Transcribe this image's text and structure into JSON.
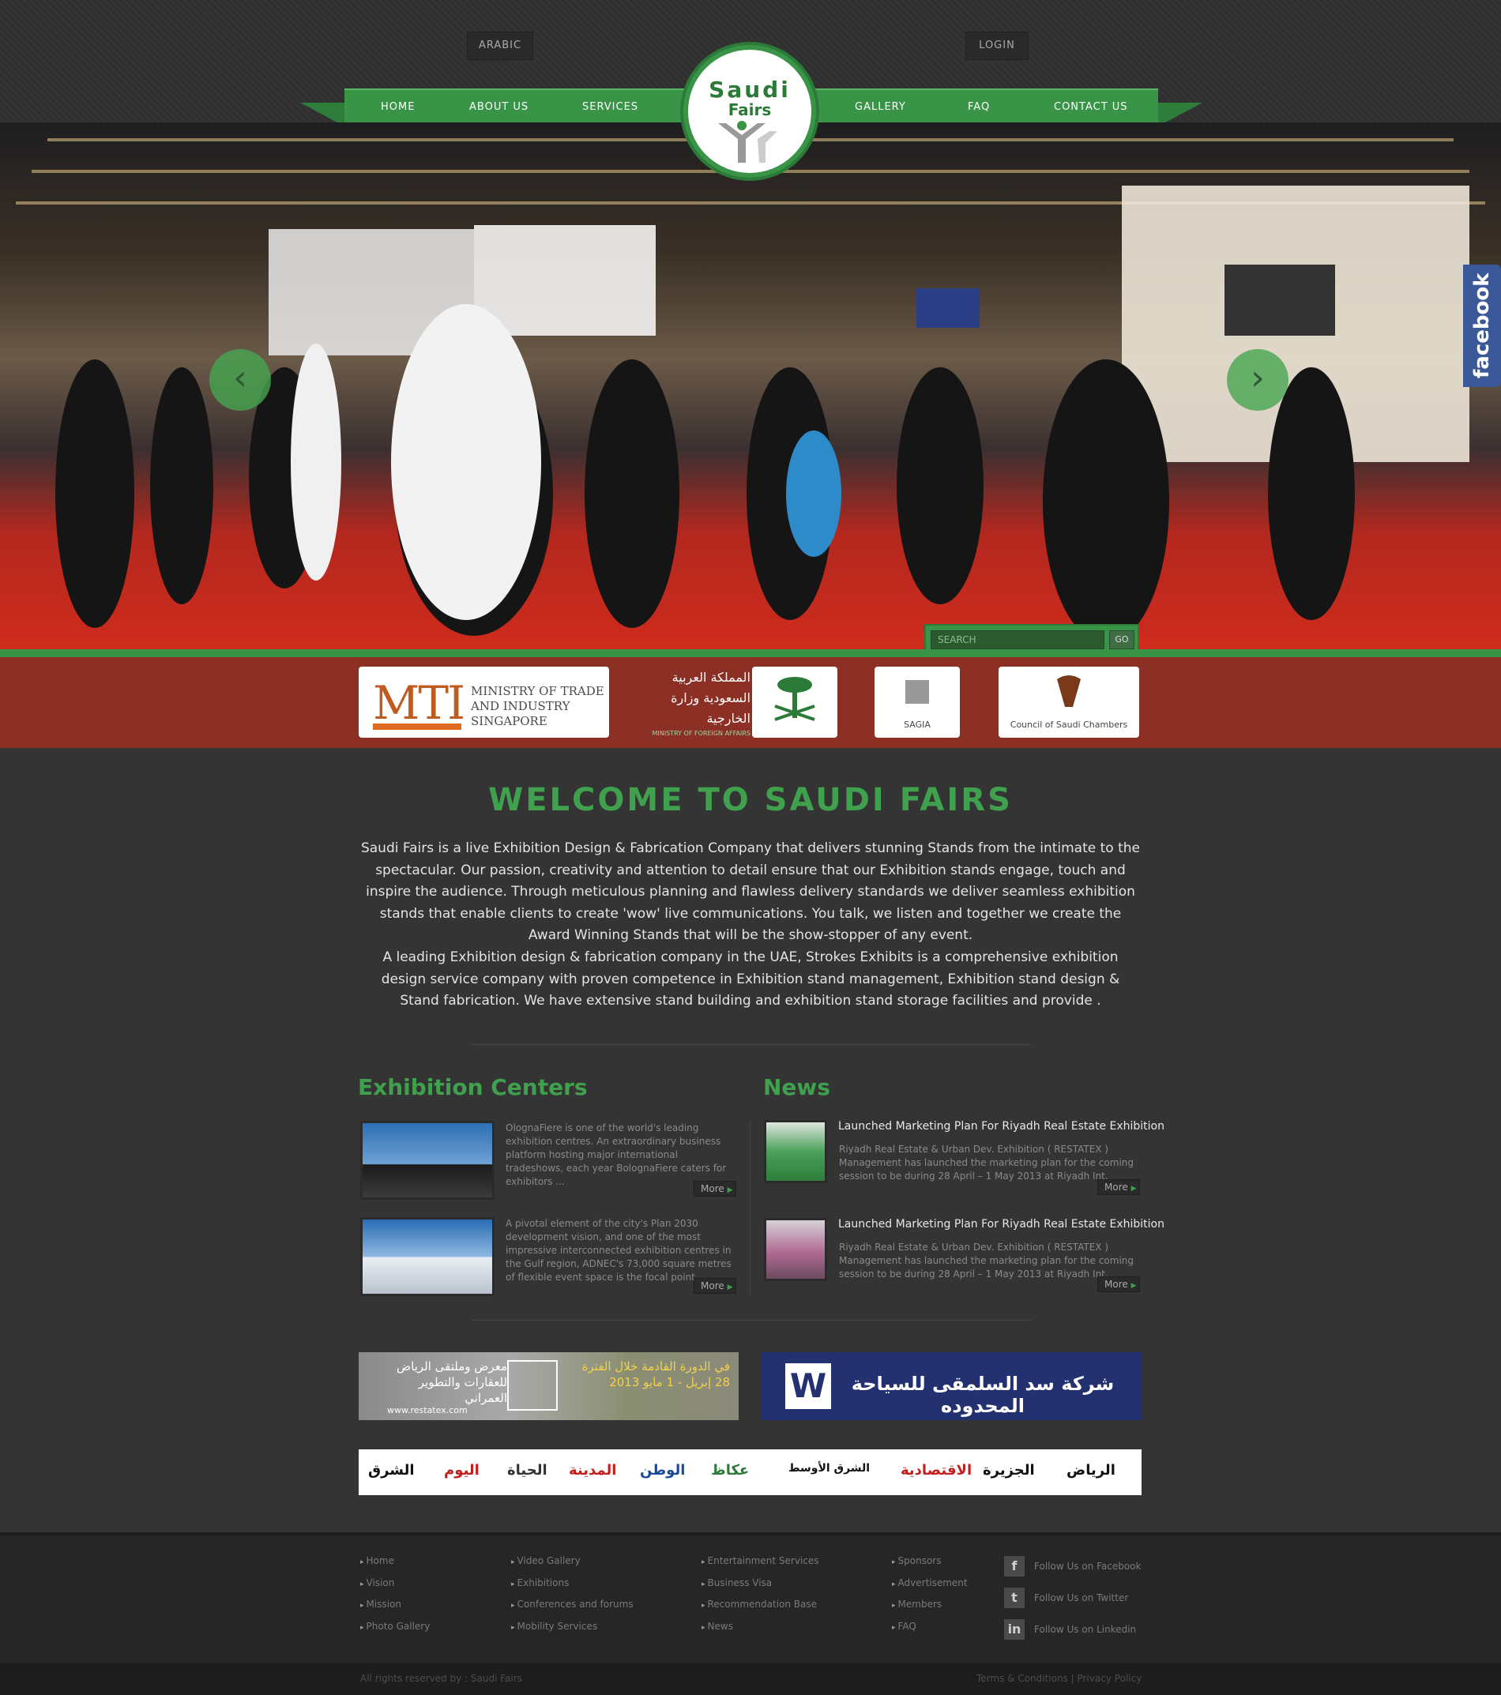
{
  "header": {
    "arabic_label": "ARABIC",
    "login_label": "LOGIN",
    "logo_line1": "Saudi",
    "logo_line2": "Fairs",
    "nav_left": [
      "HOME",
      "ABOUT US",
      "SERVICES"
    ],
    "nav_right": [
      "GALLERY",
      "FAQ",
      "CONTACT US"
    ],
    "accent_color": "#3a9448"
  },
  "hero": {
    "prev_icon": "chevron-left-icon",
    "next_icon": "chevron-right-icon",
    "facebook_tab": "facebook",
    "search_placeholder": "SEARCH",
    "go_label": "GO"
  },
  "sponsors": {
    "mti_mark": "MTI",
    "mti_lines": [
      "MINISTRY OF TRADE",
      "AND INDUSTRY",
      "SINGAPORE"
    ],
    "mfa_ar": "المملكة العربية السعودية وزارة الخارجية",
    "mfa_en": "MINISTRY OF FOREIGN AFFAIRS",
    "sagia_caption": "SAGIA",
    "council_caption": "Council of Saudi Chambers"
  },
  "welcome": {
    "title": "WELCOME TO SAUDI FAIRS",
    "para1": "Saudi Fairs is a live Exhibition Design & Fabrication Company that delivers stunning Stands from the intimate to the spectacular. Our passion, creativity and attention to detail ensure that our Exhibition stands engage, touch and inspire the audience. Through meticulous planning and flawless delivery standards we deliver seamless exhibition stands that enable clients to create 'wow' live communications. You talk, we listen and together we create the Award Winning Stands that will be the show-stopper of any event.",
    "para2": "A leading Exhibition design & fabrication company in the UAE, Strokes Exhibits is a comprehensive exhibition design service company with proven competence in Exhibition stand management, Exhibition stand design & Stand fabrication. We have extensive stand building and exhibition stand storage facilities and provide ."
  },
  "exhibition": {
    "title": "Exhibition Centers",
    "items": [
      {
        "text": "OlognaFiere is one of the world's leading exhibition centres. An extraordinary business platform hosting major international tradeshows, each year BolognaFiere caters for exhibitors ...",
        "more": "More"
      },
      {
        "text": "A pivotal element of the city's Plan 2030 development vision, and one of the most impressive interconnected exhibition centres in the Gulf region, ADNEC's 73,000 square metres of flexible event space is the focal point ...",
        "more": "More"
      }
    ]
  },
  "news": {
    "title": "News",
    "items": [
      {
        "title": "Launched Marketing Plan For Riyadh Real Estate Exhibition",
        "text": "Riyadh Real Estate & Urban Dev. Exhibition ( RESTATEX ) Management has launched the marketing plan for the coming session to be during 28 April – 1 May 2013 at Riyadh Int.",
        "more": "More"
      },
      {
        "title": "Launched Marketing Plan For Riyadh Real Estate Exhibition",
        "text": "Riyadh Real Estate & Urban Dev. Exhibition ( RESTATEX ) Management has launched the marketing plan for the coming session to be during 28 April – 1 May 2013 at Riyadh Int.",
        "more": "More"
      }
    ]
  },
  "banners": {
    "b1_left": "معرض وملتقى الرياض للعقارات والتطوير العمراني",
    "b1_right": "في الدورة القادمة خلال الفترة 28 إبريل - 1 مايو 2013",
    "b1_url": "www.restatex.com",
    "b2_text": "شركة سد السلمقى للسياحة المحدوده"
  },
  "press": [
    "الشرق",
    "اليوم",
    "الحياة",
    "المدينة",
    "الوطن",
    "عكاظ",
    "الشرق الأوسط",
    "الاقتصادية",
    "الجزيرة",
    "الرياض"
  ],
  "footer": {
    "col1": [
      "Home",
      "Vision",
      "Mission",
      "Photo Gallery"
    ],
    "col2": [
      "Video Gallery",
      "Exhibitions",
      "Conferences and forums",
      "Mobility Services"
    ],
    "col3": [
      "Entertainment Services",
      "Business Visa",
      "Recommendation Base",
      "News"
    ],
    "col4": [
      "Sponsors",
      "Advertisement",
      "Members",
      "FAQ"
    ],
    "social": [
      {
        "icon": "facebook-icon",
        "glyph": "f",
        "label": "Follow Us on Facebook"
      },
      {
        "icon": "twitter-icon",
        "glyph": "t",
        "label": "Follow Us on Twitter"
      },
      {
        "icon": "linkedin-icon",
        "glyph": "in",
        "label": "Follow Us on Linkedin"
      }
    ],
    "copyright": "All rights reserved by : Saudi Fairs",
    "terms": "Terms & Conditions",
    "separator": "|",
    "privacy": "Privacy Policy"
  }
}
